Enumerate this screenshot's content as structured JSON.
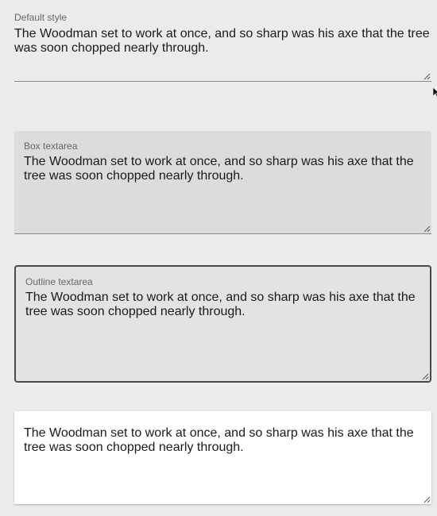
{
  "fields": [
    {
      "label": "Default style",
      "value": "The Woodman set to work at once, and so sharp was his axe that the tree was soon chopped nearly through."
    },
    {
      "label": "Box textarea",
      "value": "The Woodman set to work at once, and so sharp was his axe that the tree was soon chopped nearly through."
    },
    {
      "label": "Outline textarea",
      "value": "The Woodman set to work at once, and so sharp was his axe that the tree was soon chopped nearly through."
    },
    {
      "label": "",
      "value": "The Woodman set to work at once, and so sharp was his axe that the tree was soon chopped nearly through."
    }
  ],
  "icons": {
    "resize": "resize-grip-icon",
    "cursor": "mouse-pointer-icon"
  },
  "colors": {
    "background": "#ebebeb",
    "box_fill": "#dcdcdc",
    "outline_border": "#4a4a4a",
    "underline": "#8a8a8a"
  }
}
